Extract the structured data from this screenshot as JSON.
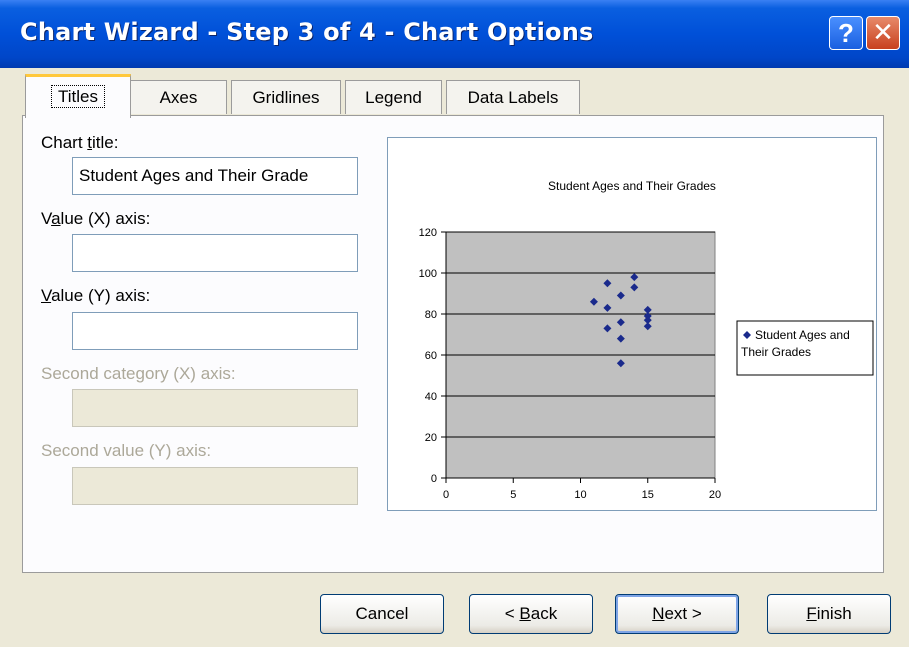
{
  "window": {
    "title": "Chart Wizard - Step 3 of 4 - Chart Options",
    "help_label": "?",
    "close_label": "✕"
  },
  "tabs": [
    {
      "label": "Titles",
      "active": true
    },
    {
      "label": "Axes"
    },
    {
      "label": "Gridlines"
    },
    {
      "label": "Legend"
    },
    {
      "label": "Data Labels"
    }
  ],
  "form": {
    "chart_title": {
      "label_pre": "Chart ",
      "label_key": "t",
      "label_post": "itle:",
      "value": "Student Ages and Their Grade"
    },
    "value_x_axis": {
      "label_pre": "V",
      "label_key": "a",
      "label_post": "lue (X) axis:",
      "value": ""
    },
    "value_y_axis": {
      "label_pre": "",
      "label_key": "V",
      "label_post": "alue (Y) axis:",
      "value": ""
    },
    "second_category_x_axis": {
      "label": "Second category (X) axis:",
      "value": ""
    },
    "second_value_y_axis": {
      "label": "Second value (Y) axis:",
      "value": ""
    }
  },
  "buttons": {
    "cancel": {
      "pre": "Cancel",
      "key": "",
      "post": ""
    },
    "back": {
      "pre": "< ",
      "key": "B",
      "post": "ack"
    },
    "next": {
      "pre": "",
      "key": "N",
      "post": "ext >"
    },
    "finish": {
      "pre": "",
      "key": "F",
      "post": "inish"
    }
  },
  "chart_data": {
    "type": "scatter",
    "title": "Student Ages and Their Grades",
    "xlim": [
      0,
      20
    ],
    "ylim": [
      0,
      120
    ],
    "xticks": [
      "0",
      "5",
      "10",
      "15",
      "20"
    ],
    "yticks": [
      "0",
      "20",
      "40",
      "60",
      "80",
      "100",
      "120"
    ],
    "grid": "horizontal",
    "legend_position": "right",
    "plot_background": "#c0c0c0",
    "marker_color": "#1a2a8c",
    "series": [
      {
        "name": "Student Ages and Their Grades",
        "points": [
          [
            11,
            86
          ],
          [
            12,
            95
          ],
          [
            12,
            83
          ],
          [
            12,
            73
          ],
          [
            13,
            89
          ],
          [
            13,
            76
          ],
          [
            13,
            68
          ],
          [
            13,
            56
          ],
          [
            14,
            98
          ],
          [
            14,
            93
          ],
          [
            15,
            82
          ],
          [
            15,
            79
          ],
          [
            15,
            77
          ],
          [
            15,
            74
          ]
        ]
      }
    ]
  }
}
